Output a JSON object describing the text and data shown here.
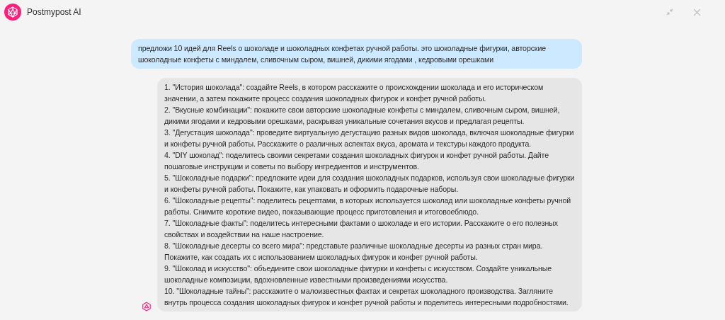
{
  "window": {
    "title": "Postmypost AI"
  },
  "messages": [
    {
      "kind": "user",
      "paragraphs": [
        "предложи 10 идей для Reels о шоколаде и шоколадных конфетах ручной работы. это шоколадные фигурки, авторские шоколадные конфеты с миндалем, сливочным сыром, вишней, дикими ягодами , кедровыми орешками"
      ]
    },
    {
      "kind": "assistant",
      "paragraphs": [
        "1. \"История шоколада\": создайте Reels, в котором расскажите о происхождении шоколада и его историческом значении, а затем покажите процесс создания шоколадных фигурок и конфет ручной работы.",
        "2. \"Вкусные комбинации\": покажите свои авторские шоколадные конфеты с миндалем, сливочным сыром, вишней, дикими ягодами и кедровыми орешками, раскрывая уникальные сочетания вкусов и предлагая рецепты.",
        "3. \"Дегустация шоколада\": проведите виртуальную дегустацию разных видов шоколада, включая шоколадные фигурки и конфеты ручной работы. Расскажите о различных аспектах вкуса, аромата и текстуры каждого продукта.",
        "4. \"DIY шоколад\": поделитесь своими секретами создания шоколадных фигурок и конфет ручной работы. Дайте пошаговые инструкции и советы по выбору ингредиентов и инструментов.",
        "5. \"Шоколадные подарки\": предложите идеи для создания шоколадных подарков, используя свои шоколадные фигурки и конфеты ручной работы. Покажите, как упаковать и оформить подарочные наборы.",
        "6. \"Шоколадные рецепты\": поделитесь рецептами, в которых используется шоколад или шоколадные конфеты ручной работы. Снимите короткие видео, показывающие процесс приготовления и итоговоеблюдо.",
        "7. \"Шоколадные факты\": поделитесь интересными фактами о шоколаде и его истории. Расскажите о его полезных свойствах и воздействии на наше настроение.",
        "8. \"Шоколадные десерты со всего мира\": представьте различные шоколадные десерты из разных стран мира. Покажите, как создать их с использованием шоколадных фигурок и конфет ручной работы.",
        "9. \"Шоколад и искусство\": объедините свои шоколадные фигурки и конфеты с искусством. Создайте уникальные шоколадные композиции, вдохновленные известными произведениями искусства.",
        "10. \"Шоколадные тайны\": расскажите о малоизвестных фактах и секретах шоколадного производства. Загляните внутрь процесса создания шоколадных фигурок и конфет ручной работы и поделитесь интересными подробностями."
      ]
    }
  ]
}
